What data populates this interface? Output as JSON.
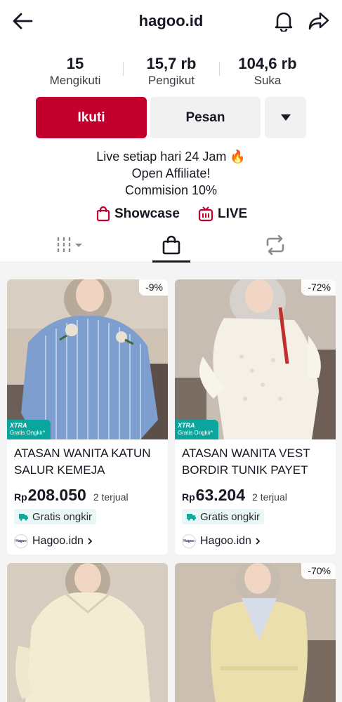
{
  "header": {
    "title": "hagoo.id"
  },
  "stats": [
    {
      "value": "15",
      "label": "Mengikuti"
    },
    {
      "value": "15,7 rb",
      "label": "Pengikut"
    },
    {
      "value": "104,6 rb",
      "label": "Suka"
    }
  ],
  "actions": {
    "follow": "Ikuti",
    "message": "Pesan"
  },
  "bio": {
    "line1": "Live setiap hari 24 Jam 🔥",
    "line2": "Open Affiliate!",
    "line3": "Commision 10%"
  },
  "links": {
    "showcase": "Showcase",
    "live": "LIVE"
  },
  "colors": {
    "accent": "#c2002d",
    "ship_bg": "#e9f8f6",
    "xtra": "#0aa59c"
  },
  "products": [
    {
      "discount": "-9%",
      "xtra_label": "XTRA",
      "xtra_sub": "Gratis Ongkir*",
      "name": "ATASAN WANITA KATUN SALUR KEMEJA WANITA...",
      "currency": "Rp",
      "price": "208.050",
      "sold": "2 terjual",
      "shipping": "Gratis ongkir",
      "seller_logo": "Hagoo",
      "seller": "Hagoo.idn"
    },
    {
      "discount": "-72%",
      "xtra_label": "XTRA",
      "xtra_sub": "Gratis Ongkir*",
      "name": "ATASAN WANITA VEST BORDIR TUNIK PAYET BLOUSE...",
      "currency": "Rp",
      "price": "63.204",
      "sold": "2 terjual",
      "shipping": "Gratis ongkir",
      "seller_logo": "Hagoo",
      "seller": "Hagoo.idn"
    },
    {
      "discount": "",
      "name": "",
      "price": ""
    },
    {
      "discount": "-70%",
      "name": "",
      "price": ""
    }
  ]
}
